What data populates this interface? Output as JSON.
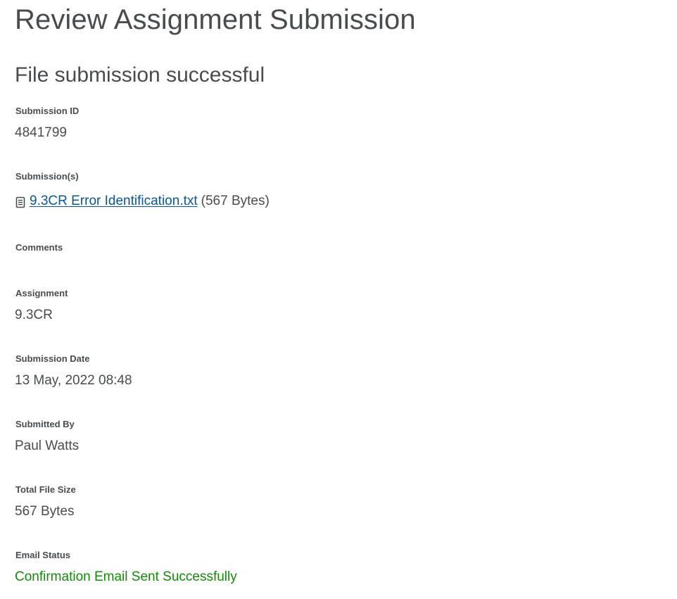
{
  "page": {
    "title": "Review Assignment Submission",
    "subtitle": "File submission successful"
  },
  "fields": {
    "submission_id": {
      "label": "Submission ID",
      "value": "4841799"
    },
    "submissions": {
      "label": "Submission(s)",
      "file_name": "9.3CR Error Identification.txt",
      "file_size": "(567 Bytes)",
      "icon": "document-icon"
    },
    "comments": {
      "label": "Comments",
      "value": ""
    },
    "assignment": {
      "label": "Assignment",
      "value": "9.3CR"
    },
    "submission_date": {
      "label": "Submission Date",
      "value": "13 May, 2022 08:48"
    },
    "submitted_by": {
      "label": "Submitted By",
      "value": "Paul Watts"
    },
    "total_file_size": {
      "label": "Total File Size",
      "value": "567 Bytes"
    },
    "email_status": {
      "label": "Email Status",
      "value": "Confirmation Email Sent Successfully"
    }
  },
  "colors": {
    "text": "#494c4e",
    "link": "#0a5792",
    "success": "#138a07"
  }
}
